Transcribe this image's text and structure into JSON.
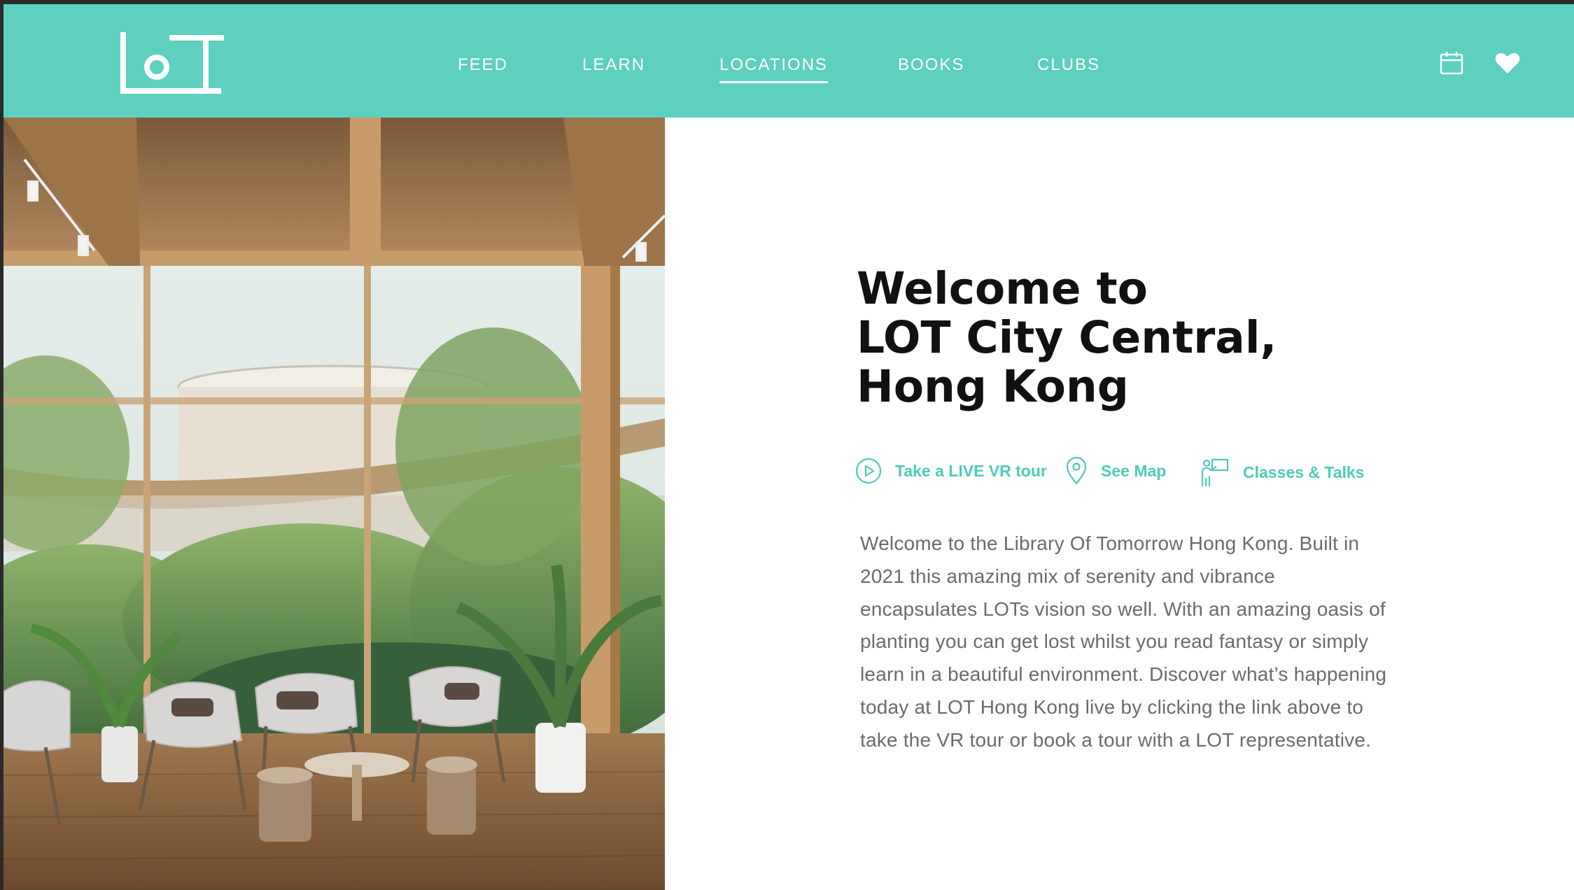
{
  "nav": {
    "logo_text": "LOT",
    "items": [
      {
        "label": "FEED"
      },
      {
        "label": "LEARN"
      },
      {
        "label": "LOCATIONS",
        "active": true
      },
      {
        "label": "BOOKS"
      },
      {
        "label": "CLUBS"
      }
    ],
    "icons": [
      "calendar-icon",
      "heart-icon"
    ]
  },
  "colors": {
    "brand_teal": "#5dd0c0",
    "link_teal": "#4fcab9",
    "title_text": "#111111",
    "body_text": "#6b6b6b"
  },
  "content": {
    "title_lines": [
      "Welcome to",
      "LOT City Central,",
      "Hong Kong"
    ],
    "actions": [
      {
        "icon": "play-circle-icon",
        "label": "Take a LIVE VR tour"
      },
      {
        "icon": "map-pin-icon",
        "label": "See Map"
      },
      {
        "icon": "presenter-icon",
        "label": "Classes & Talks"
      }
    ],
    "description": "Welcome to the Library Of Tomorrow Hong Kong. Built in 2021 this amazing mix of serenity and vibrance encapsulates LOTs vision so well. With an amazing oasis of planting you can get lost whilst you read fantasy or simply learn in a beautiful environment. Discover what’s happening today at LOT Hong Kong live by clicking the link above to take the VR tour or book a tour with a LOT representative."
  }
}
